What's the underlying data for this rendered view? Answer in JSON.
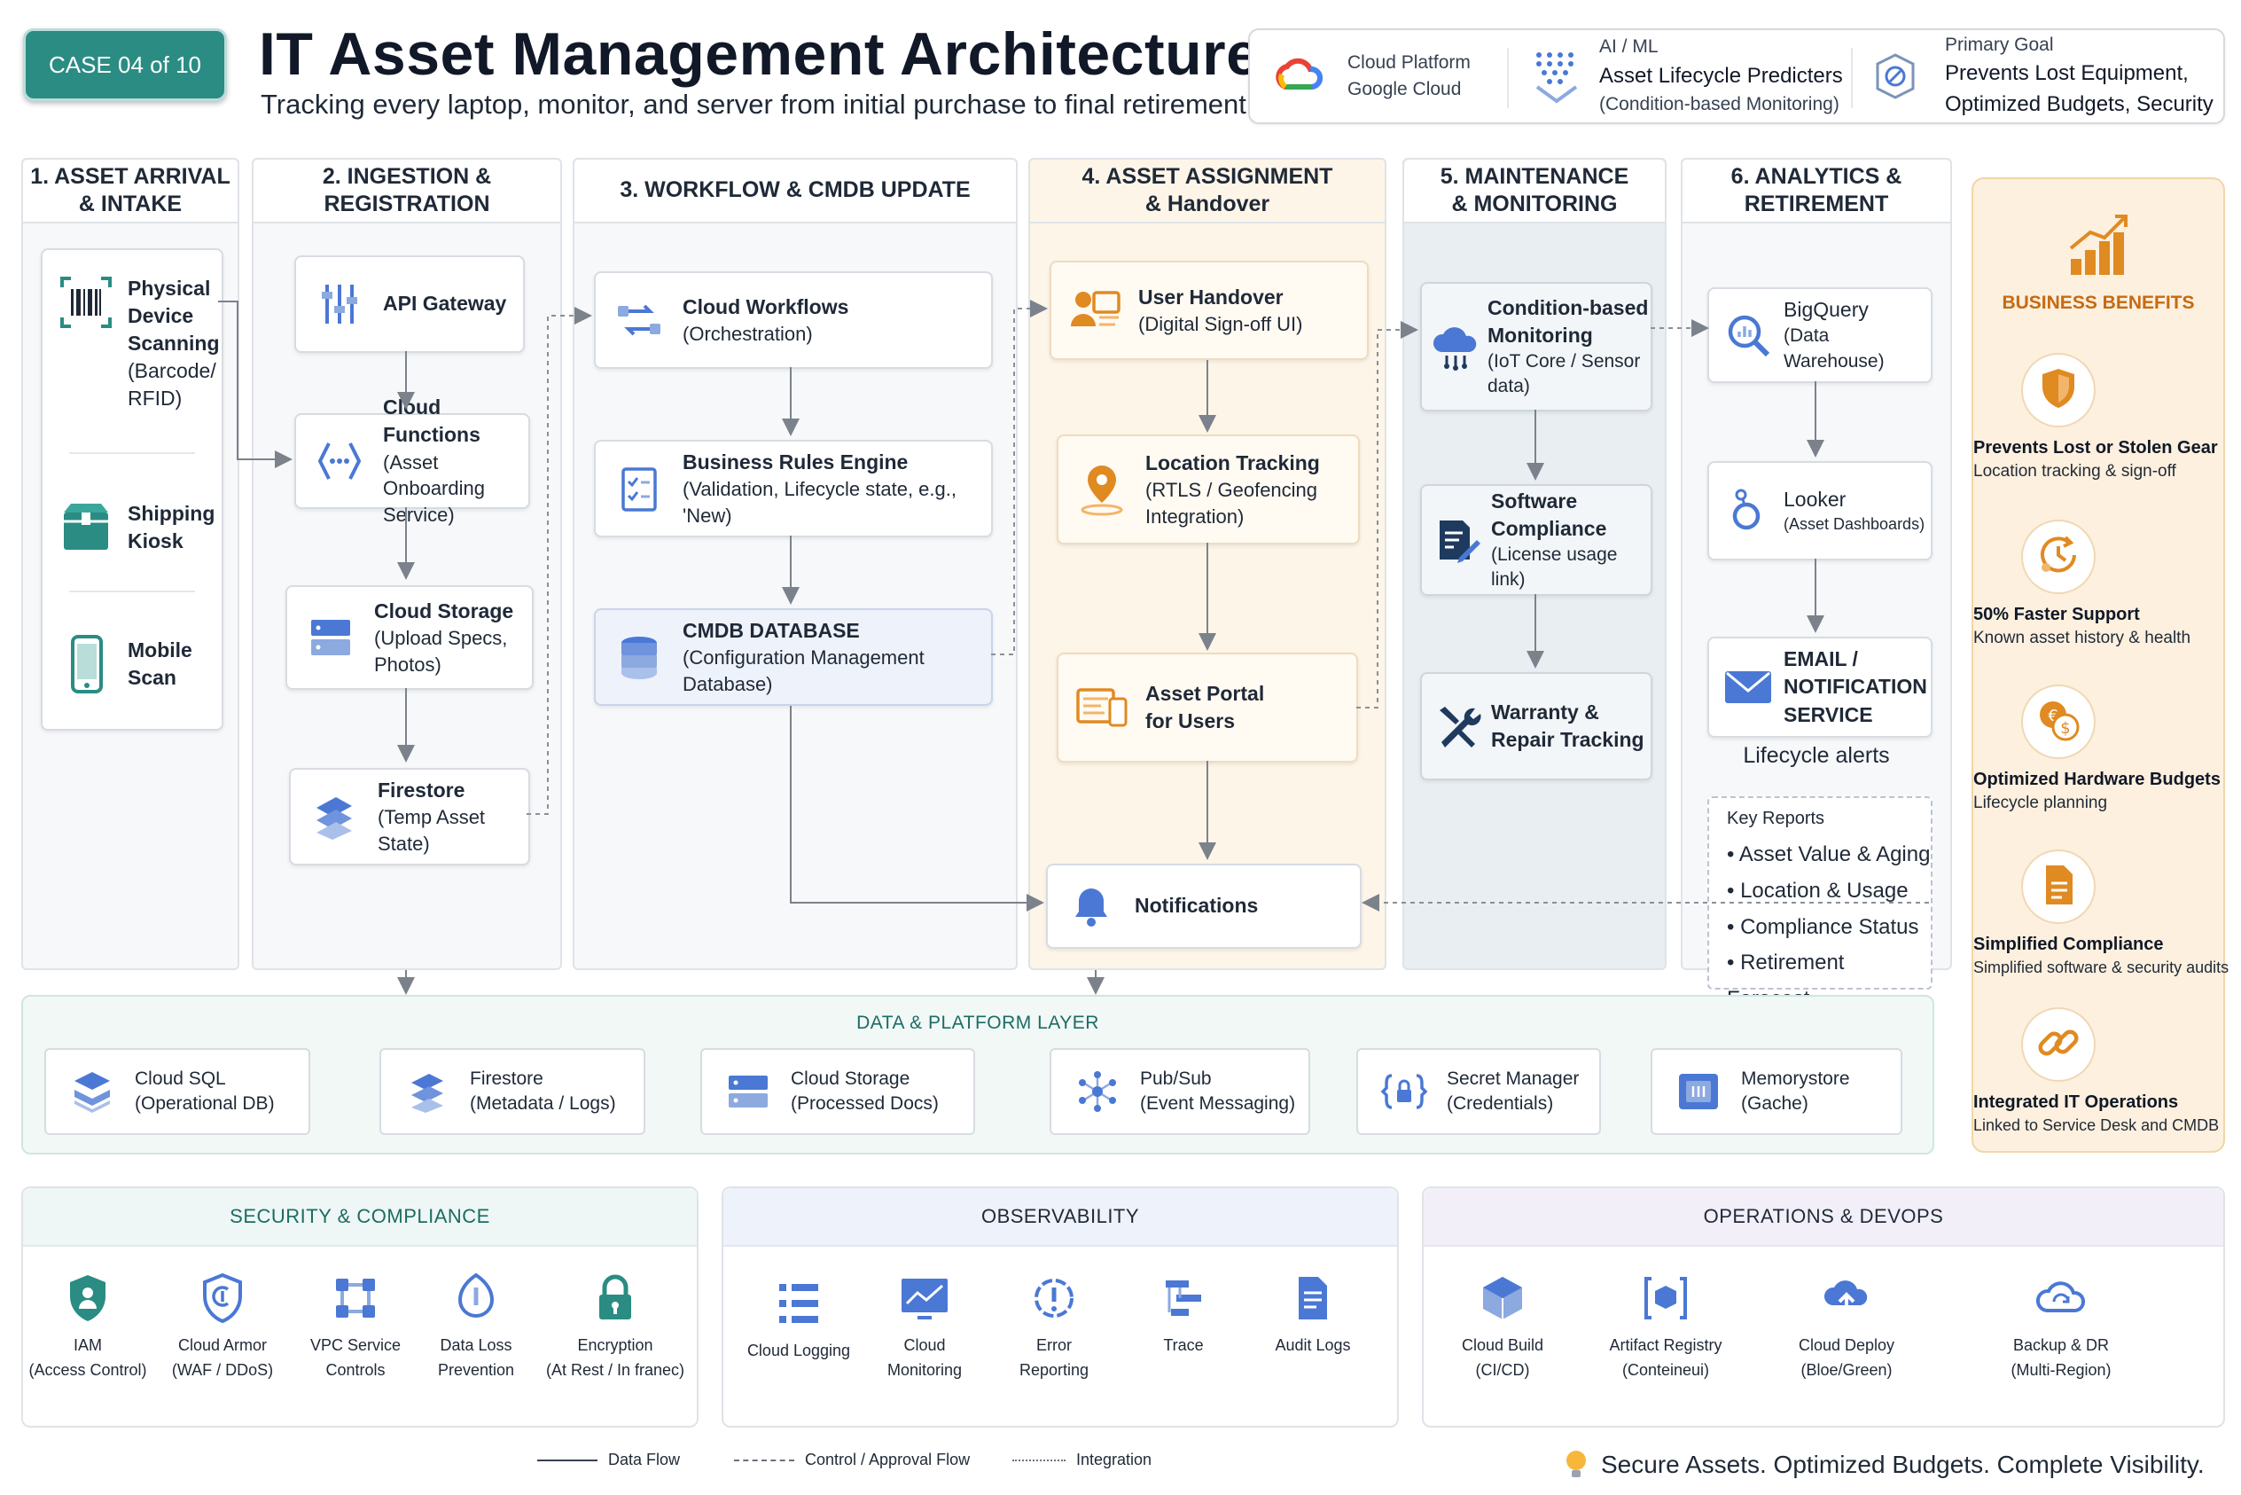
{
  "header": {
    "case_badge": "CASE 04 of 10",
    "title": "IT Asset Management Architecture",
    "subtitle": "Tracking every laptop, monitor, and server from initial purchase to final retirement",
    "platform_line1": "Cloud Platform",
    "platform_line2": "Google Cloud",
    "ai_label": "AI / ML",
    "ai_line1": "Asset Lifecycle Predicters",
    "ai_line2": "(Condition-based Monitoring)",
    "goal_label": "Primary Goal",
    "goal_line1": "Prevents Lost Equipment,",
    "goal_line2": "Optimized Budgets, Security"
  },
  "stages": {
    "s1": {
      "title_l1": "1. ASSET ARRIVAL",
      "title_l2": "& INTAKE",
      "items": [
        {
          "title": "Physical",
          "l2": "Device",
          "l3": "Scanning",
          "l4": "(Barcode/",
          "l5": "RFID)"
        },
        {
          "title": "Shipping",
          "l2": "Kiosk"
        },
        {
          "title": "Mobile",
          "l2": "Scan"
        }
      ]
    },
    "s2": {
      "title_l1": "2. INGESTION &",
      "title_l2": "REGISTRATION",
      "api": "API Gateway",
      "functions_t": "Cloud Functions",
      "functions_d1": "(Asset Onboarding",
      "functions_d2": "Service)",
      "storage_t": "Cloud Storage",
      "storage_d1": "(Upload Specs,",
      "storage_d2": "Photos)",
      "firestore_t": "Firestore",
      "firestore_d": "(Temp Asset State)"
    },
    "s3": {
      "title": "3. WORKFLOW & CMDB UPDATE",
      "workflows_t": "Cloud Workflows",
      "workflows_d": "(Orchestration)",
      "rules_t": "Business Rules Engine",
      "rules_d": "(Validation, Lifecycle state, e.g., 'New)",
      "cmdb_t": "CMDB DATABASE",
      "cmdb_d": "(Configuration Management Database)"
    },
    "s4": {
      "title_l1": "4. ASSET ASSIGNMENT",
      "title_l2": "& Handover",
      "handover_t": "User Handover",
      "handover_d": "(Digital Sign-off UI)",
      "location_t": "Location Tracking",
      "location_d1": "(RTLS / Geofencing",
      "location_d2": "Integration)",
      "portal_t1": "Asset Portal",
      "portal_t2": "for Users",
      "notifications": "Notifications"
    },
    "s5": {
      "title_l1": "5. MAINTENANCE",
      "title_l2": "& MONITORING",
      "cbm_t1": "Condition-based",
      "cbm_t2": "Monitoring",
      "cbm_d1": "(IoT Core / Sensor",
      "cbm_d2": "data)",
      "sw_t1": "Software",
      "sw_t2": "Compliance",
      "sw_d": "(License usage link)",
      "warranty_t1": "Warranty &",
      "warranty_t2": "Repair Tracking"
    },
    "s6": {
      "title_l1": "6. ANALYTICS &",
      "title_l2": "RETIREMENT",
      "bq_t": "BigQuery",
      "bq_d": "(Data Warehouse)",
      "looker_t": "Looker",
      "looker_d": "(Asset Dashboards)",
      "email_t1": "EMAIL /",
      "email_t2": "NOTIFICATION",
      "email_t3": "SERVICE",
      "lifecycle": "Lifecycle alerts",
      "reports_title": "Key Reports",
      "reports": [
        "Asset Value & Aging",
        "Location & Usage",
        "Compliance Status",
        "Retirement Forecast"
      ]
    }
  },
  "benefits": {
    "title": "BUSINESS BENEFITS",
    "items": [
      {
        "title": "Prevents Lost or Stolen Gear",
        "desc": "Location tracking & sign-off"
      },
      {
        "title": "50% Faster Support",
        "desc": "Known asset history & health"
      },
      {
        "title": "Optimized Hardware Budgets",
        "desc": "Lifecycle planning"
      },
      {
        "title": "Simplified Compliance",
        "desc": "Simplified software & security audits"
      },
      {
        "title": "Integrated IT Operations",
        "desc": "Linked to Service Desk and CMDB"
      }
    ]
  },
  "platform": {
    "title": "DATA & PLATFORM LAYER",
    "items": [
      {
        "name": "Cloud SQL",
        "desc": "(Operational DB)"
      },
      {
        "name": "Firestore",
        "desc": "(Metadata / Logs)"
      },
      {
        "name": "Cloud Storage",
        "desc": "(Processed Docs)"
      },
      {
        "name": "Pub/Sub",
        "desc": "(Event Messaging)"
      },
      {
        "name": "Secret Manager",
        "desc": "(Credentials)"
      },
      {
        "name": "Memorystore",
        "desc": "(Gache)"
      }
    ]
  },
  "security": {
    "title": "SECURITY & COMPLIANCE",
    "items": [
      {
        "l1": "IAM",
        "l2": "(Access Control)"
      },
      {
        "l1": "Cloud Armor",
        "l2": "(WAF / DDoS)"
      },
      {
        "l1": "VPC Service",
        "l2": "Controls"
      },
      {
        "l1": "Data Loss",
        "l2": "Prevention"
      },
      {
        "l1": "Encryption",
        "l2": "(At Rest / In franec)"
      }
    ]
  },
  "observability": {
    "title": "OBSERVABILITY",
    "items": [
      {
        "l1": "Cloud Logging",
        "l2": ""
      },
      {
        "l1": "Cloud",
        "l2": "Monitoring"
      },
      {
        "l1": "Error",
        "l2": "Reporting"
      },
      {
        "l1": "Trace",
        "l2": ""
      },
      {
        "l1": "Audit Logs",
        "l2": ""
      }
    ]
  },
  "operations": {
    "title": "OPERATIONS & DEVOPS",
    "items": [
      {
        "l1": "Cloud Build",
        "l2": "(CI/CD)"
      },
      {
        "l1": "Artifact Registry",
        "l2": "(Conteineui)"
      },
      {
        "l1": "Cloud Deploy",
        "l2": "(Bloe/Green)"
      },
      {
        "l1": "Backup & DR",
        "l2": "(Multi-Region)"
      }
    ]
  },
  "legend": {
    "data_flow": "Data Flow",
    "control_flow": "Control / Approval Flow",
    "integration": "Integration"
  },
  "tagline": "Secure Assets. Optimized Budgets. Complete Visibility.",
  "colors": {
    "teal": "#2a8c83",
    "blue_icon": "#4a78d4",
    "orange_icon": "#e08a22",
    "navy_icon": "#1f3a5f",
    "benefit_heading": "#c66a12"
  }
}
